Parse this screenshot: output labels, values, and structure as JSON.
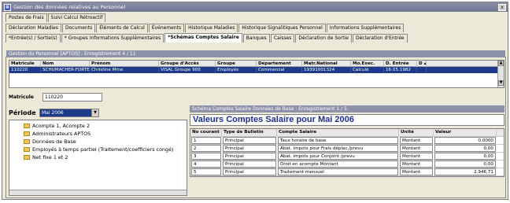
{
  "window": {
    "title": "Gestion des données relatives au Personnel",
    "close": "x"
  },
  "tabs_row1": [
    "Postes de Frais",
    "Suivi Calcul Rétroactif"
  ],
  "tabs_row2": [
    "Déclaration Maladies",
    "Documents",
    "Éléments de Calcul",
    "Événements",
    "Historique Maladies",
    "Historique Signalitiques Personnel",
    "Informations Supplémentaires"
  ],
  "tabs_row3": [
    "*Entrée(s) / Sortie(s)",
    "* Groupes Informations Supplémentaires",
    "*Schémas Comptes Salaire",
    "Banques",
    "Caisses",
    "Déclaration de Sortie",
    "Déclaration d'Entrée"
  ],
  "active_tab": "*Schémas Comptes Salaire",
  "personnel": {
    "header": "Gestion du Personnel [APTOS] : Enregistrement 4 / 11",
    "columns": [
      "Matricule",
      "Nom",
      "Prénom",
      "Groupe d'Accès",
      "Groupe",
      "Département",
      "Matr.National",
      "Mo.Exec.",
      "D. Entrée",
      "D ▴"
    ],
    "row": [
      "110220",
      "SCHUMACHER-FORTES",
      "Christine Mme",
      "VISAL Groupe 900",
      "Employés",
      "Commercial",
      "19391001324",
      "Calculé",
      "16.05.1982",
      ""
    ]
  },
  "matricule": {
    "label": "Matricule",
    "value": "110220"
  },
  "periode": {
    "label": "Période",
    "value": "Mai 2006"
  },
  "tree_items": [
    "Acompte 1, Acompte 2",
    "Administrateurs APTOS",
    "Données de Base",
    "Employés à temps partiel (Traitement/coefficiers congé)",
    "Net fixe 1 et 2"
  ],
  "schema": {
    "header": "Schéma Comptes Salaire Données de Base : Enregistrement 1 / 5",
    "title": "Valeurs Comptes Salaire pour Mai 2006",
    "columns": [
      "No courant",
      "Type de Bulletin",
      "Compte Salaire",
      "Unité",
      "Valeur"
    ],
    "rows": [
      [
        "1",
        "Principal",
        "Taux horaire de base",
        "Montant",
        "0,0000"
      ],
      [
        "2",
        "Principal",
        "Abat. impots pour Frais déplac./prevu",
        "Montant",
        "0,00"
      ],
      [
        "3",
        "Principal",
        "Abat. impots pour Conjoint  /prevu",
        "Montant",
        "0,00"
      ],
      [
        "4",
        "Principal",
        "Droit en acompte Montant",
        "Montant",
        "0,00"
      ],
      [
        "5",
        "Principal",
        "Traitement mensuel",
        "Montant",
        "2.946,71"
      ]
    ]
  }
}
